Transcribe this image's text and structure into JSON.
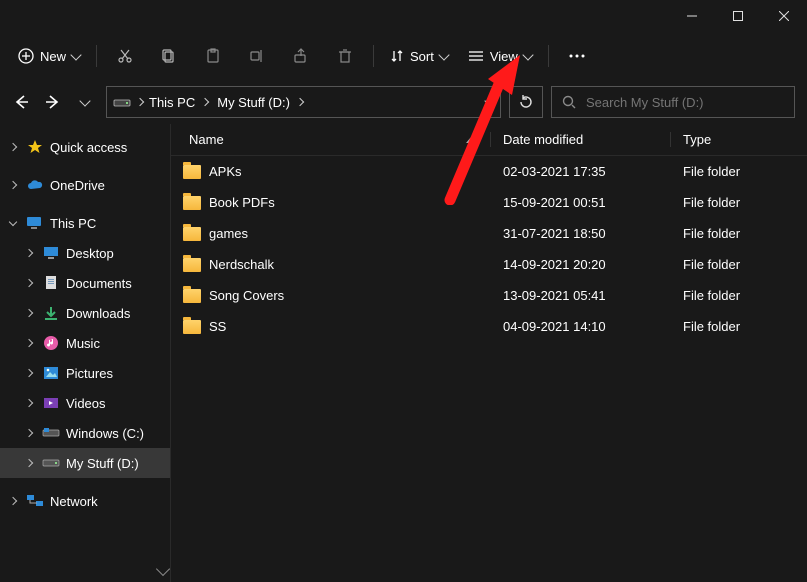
{
  "window": {
    "min": "min",
    "max": "max",
    "close": "close"
  },
  "toolbar": {
    "new_label": "New",
    "sort_label": "Sort",
    "view_label": "View"
  },
  "address": {
    "crumb1": "This PC",
    "crumb2": "My Stuff (D:)"
  },
  "search": {
    "placeholder": "Search My Stuff (D:)"
  },
  "sidebar": {
    "quick_access": "Quick access",
    "onedrive": "OneDrive",
    "this_pc": "This PC",
    "desktop": "Desktop",
    "documents": "Documents",
    "downloads": "Downloads",
    "music": "Music",
    "pictures": "Pictures",
    "videos": "Videos",
    "windows_c": "Windows (C:)",
    "my_stuff_d": "My Stuff (D:)",
    "network": "Network"
  },
  "columns": {
    "name": "Name",
    "date": "Date modified",
    "type": "Type"
  },
  "rows": [
    {
      "name": "APKs",
      "date": "02-03-2021 17:35",
      "type": "File folder"
    },
    {
      "name": "Book PDFs",
      "date": "15-09-2021 00:51",
      "type": "File folder"
    },
    {
      "name": "games",
      "date": "31-07-2021 18:50",
      "type": "File folder"
    },
    {
      "name": "Nerdschalk",
      "date": "14-09-2021 20:20",
      "type": "File folder"
    },
    {
      "name": "Song Covers",
      "date": "13-09-2021 05:41",
      "type": "File folder"
    },
    {
      "name": "SS",
      "date": "04-09-2021 14:10",
      "type": "File folder"
    }
  ]
}
